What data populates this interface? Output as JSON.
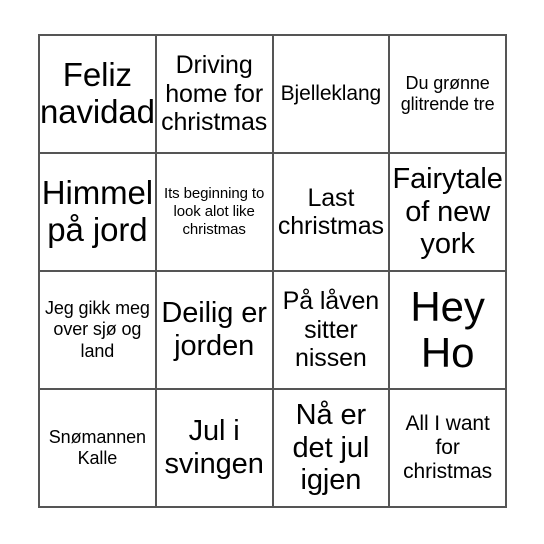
{
  "card": {
    "type": "bingo-card",
    "rows": 4,
    "columns": 4,
    "border_color": "#555555",
    "background_color": "#ffffff",
    "text_color": "#000000",
    "cells": [
      {
        "text": "Feliz navidad",
        "size": "xl"
      },
      {
        "text": "Driving home for christmas",
        "size": "md"
      },
      {
        "text": "Bjelleklang",
        "size": "sm"
      },
      {
        "text": "Du grønne glitrende tre",
        "size": "xs"
      },
      {
        "text": "Himmel på jord",
        "size": "xl"
      },
      {
        "text": "Its beginning to look alot like christmas",
        "size": "xxs"
      },
      {
        "text": "Last christmas",
        "size": "md"
      },
      {
        "text": "Fairytale of new york",
        "size": "lg"
      },
      {
        "text": "Jeg gikk meg over sjø og land",
        "size": "xs"
      },
      {
        "text": "Deilig er jorden",
        "size": "lg"
      },
      {
        "text": "På låven sitter nissen",
        "size": "md"
      },
      {
        "text": "Hey Ho",
        "size": "xxl"
      },
      {
        "text": "Snømannen Kalle",
        "size": "xs"
      },
      {
        "text": "Jul i svingen",
        "size": "lg"
      },
      {
        "text": "Nå er det jul igjen",
        "size": "lg"
      },
      {
        "text": "All I want for christmas",
        "size": "sm"
      }
    ]
  }
}
